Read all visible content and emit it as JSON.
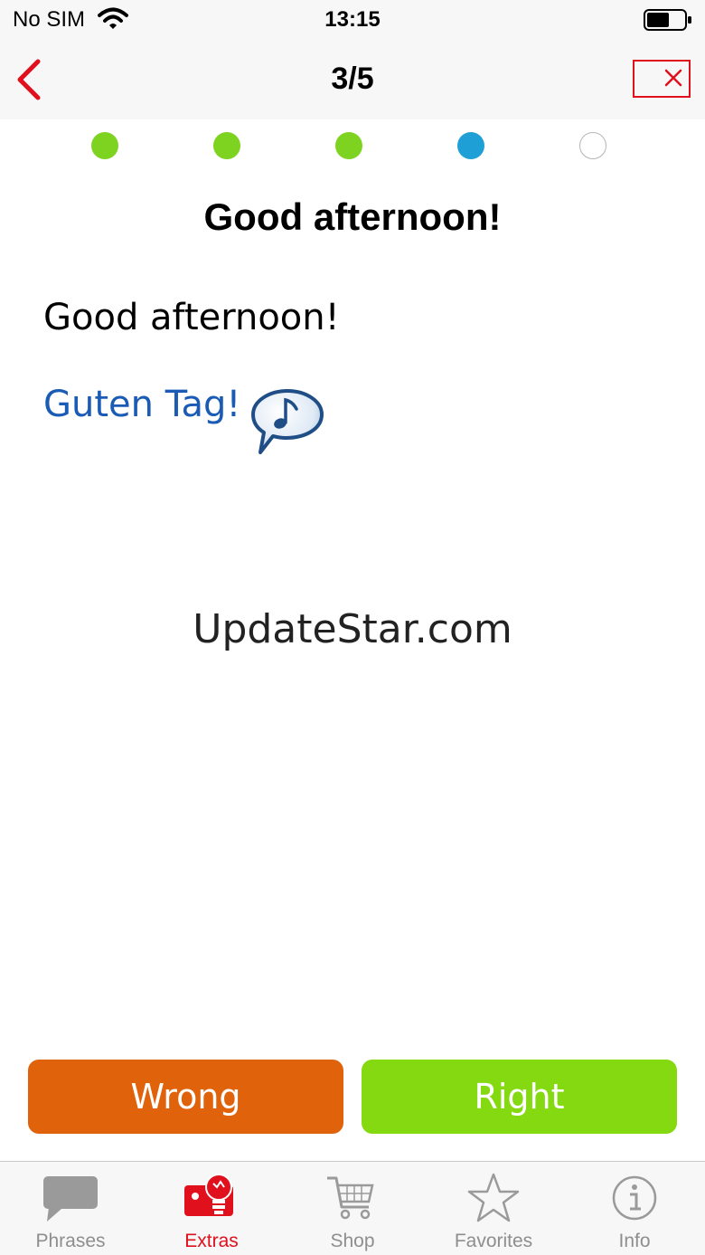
{
  "status_bar": {
    "carrier": "No SIM",
    "time": "13:15"
  },
  "nav": {
    "title": "3/5"
  },
  "progress": {
    "states": [
      "done",
      "done",
      "done",
      "current",
      "pending"
    ]
  },
  "card": {
    "heading": "Good afternoon!",
    "source_text": "Good afternoon!",
    "target_text": "Guten Tag!"
  },
  "watermark": "UpdateStar.com",
  "buttons": {
    "wrong_label": "Wrong",
    "right_label": "Right"
  },
  "tabs": [
    {
      "label": "Phrases",
      "icon": "speech-bubble-icon"
    },
    {
      "label": "Extras",
      "icon": "lightbulb-icon"
    },
    {
      "label": "Shop",
      "icon": "cart-icon"
    },
    {
      "label": "Favorites",
      "icon": "star-icon"
    },
    {
      "label": "Info",
      "icon": "info-icon"
    }
  ],
  "colors": {
    "accent_red": "#e0101d",
    "wrong": "#e0630b",
    "right": "#84d911",
    "dot_done": "#7ed321",
    "dot_current": "#1ea0d6",
    "target_text": "#1a5bb5"
  }
}
